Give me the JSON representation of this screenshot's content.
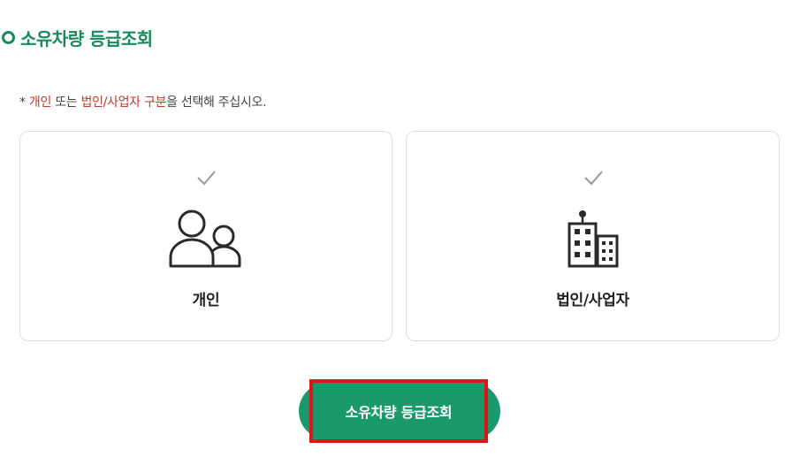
{
  "section": {
    "title": "소유차량 등급조회"
  },
  "notice": {
    "prefix": "* ",
    "personal": "개인",
    "connector": " 또는 ",
    "corporate": "법인/사업자",
    "space": " ",
    "division": "구분",
    "suffix": "을 선택해 주십시오."
  },
  "options": [
    {
      "label": "개인",
      "icon": "person-group-icon"
    },
    {
      "label": "법인/사업자",
      "icon": "building-icon"
    }
  ],
  "submit": {
    "label": "소유차량 등급조회"
  },
  "colors": {
    "accent_green": "#1a8a5c",
    "button_green": "#1a9a6a",
    "highlight_red": "#e01616",
    "notice_red": "#c0392b"
  }
}
